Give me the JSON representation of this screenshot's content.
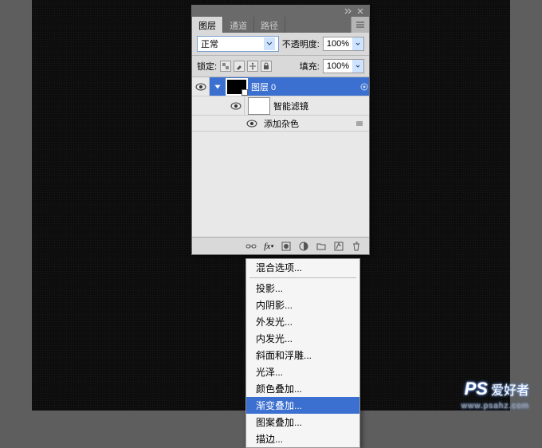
{
  "panel": {
    "tabs": {
      "layers": "图层",
      "channels": "通道",
      "paths": "路径"
    },
    "blend_label": "正常",
    "opacity_label": "不透明度:",
    "opacity_value": "100%",
    "lock_label": "锁定:",
    "fill_label": "填充:",
    "fill_value": "100%"
  },
  "layers": {
    "main": "图层 0",
    "smartfilters": "智能滤镜",
    "addnoise": "添加杂色"
  },
  "fx_menu": {
    "items": [
      {
        "label": "混合选项...",
        "sep": true
      },
      {
        "label": "投影..."
      },
      {
        "label": "内阴影..."
      },
      {
        "label": "外发光..."
      },
      {
        "label": "内发光..."
      },
      {
        "label": "斜面和浮雕..."
      },
      {
        "label": "光泽..."
      },
      {
        "label": "颜色叠加..."
      },
      {
        "label": "渐变叠加...",
        "hl": true
      },
      {
        "label": "图案叠加..."
      },
      {
        "label": "描边..."
      }
    ]
  },
  "watermark": {
    "ps": "PS",
    "cn": "爱好者",
    "url": "www.psahz.com"
  }
}
